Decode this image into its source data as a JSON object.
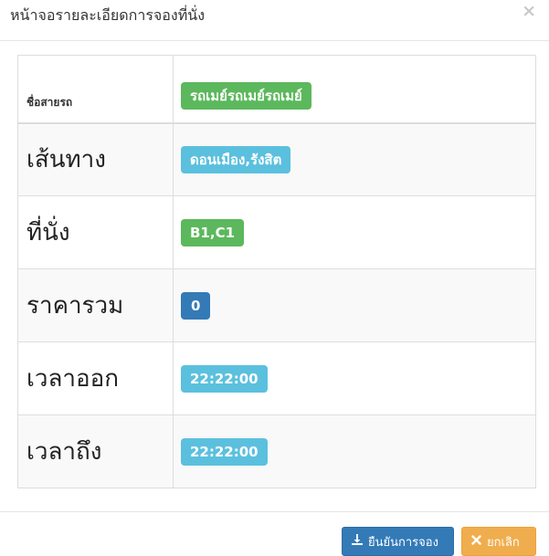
{
  "modal": {
    "title": "หน้าจอรายละเอียดการจองที่นั่ง",
    "close_label": "×"
  },
  "details": {
    "bus_name": {
      "label": "ชื่อสายรถ",
      "value": "รถเมย์รถเมย์รถเมย์"
    },
    "route": {
      "label": "เส้นทาง",
      "value": "ดอนเมือง,รังสิต"
    },
    "seats": {
      "label": "ที่นั่ง",
      "value": "B1,C1"
    },
    "total_price": {
      "label": "ราคารวม",
      "value": "0"
    },
    "departure": {
      "label": "เวลาออก",
      "value": "22:22:00"
    },
    "arrival": {
      "label": "เวลาถึง",
      "value": "22:22:00"
    }
  },
  "footer": {
    "confirm_label": "ยืนยันการจอง",
    "cancel_label": "ยกเลิก",
    "confirm_icon": "download-icon",
    "cancel_icon": "close-icon"
  },
  "colors": {
    "success": "#5cb85c",
    "info": "#5bc0de",
    "primary": "#337ab7",
    "warning": "#f0ad4e"
  }
}
